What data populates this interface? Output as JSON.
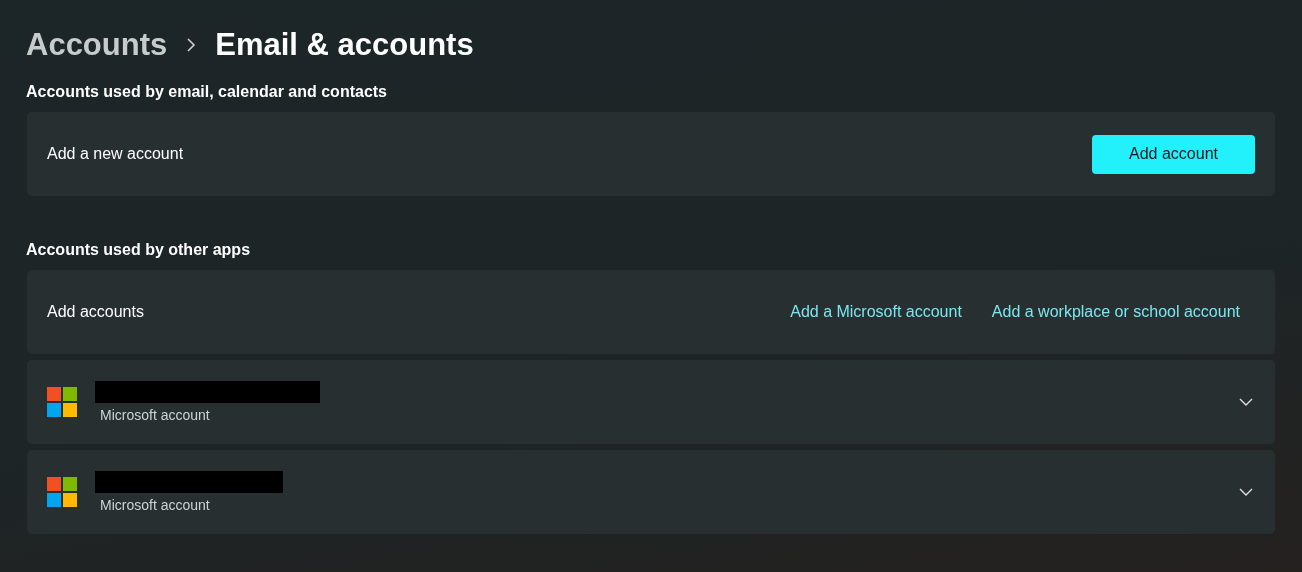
{
  "breadcrumb": [
    {
      "label": "Accounts",
      "current": false
    },
    {
      "label": "Email & accounts",
      "current": true
    }
  ],
  "sections": [
    {
      "heading": "Accounts used by email, calendar and contacts",
      "rows": [
        {
          "kind": "action",
          "label": "Add a new account",
          "button": "Add account"
        }
      ]
    },
    {
      "heading": "Accounts used by other apps",
      "rows": [
        {
          "kind": "links",
          "label": "Add accounts",
          "links": [
            "Add a Microsoft account",
            "Add a workplace or school account"
          ]
        },
        {
          "kind": "account",
          "subtitle": "Microsoft account",
          "expanded": false
        },
        {
          "kind": "account",
          "subtitle": "Microsoft account",
          "expanded": false
        }
      ]
    }
  ]
}
